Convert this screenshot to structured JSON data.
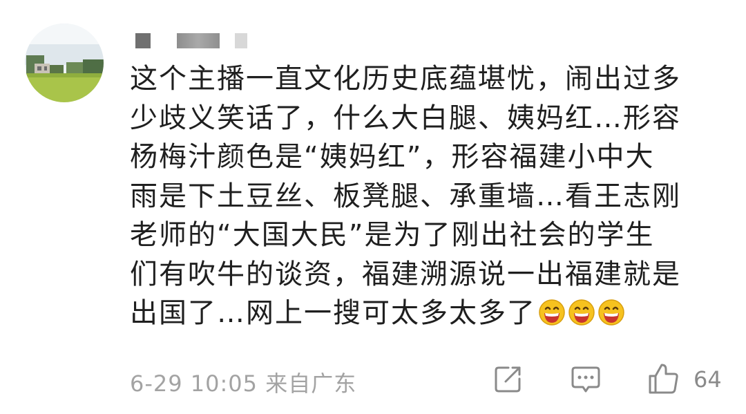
{
  "comment": {
    "lines": [
      "这个主播一直文化历史底蕴堪忧，闹出过多",
      "少歧义笑话了，什么大白腿、姨妈红…形容",
      "杨梅汁颜色是“姨妈红”，形容福建小中大",
      "雨是下土豆丝、板凳腿、承重墙…看王志刚",
      "老师的“大国大民”是为了刚出社会的学生",
      "们有吹牛的谈资，福建溯源说一出福建就是",
      "出国了…网上一搜可太多太多了"
    ],
    "emojis": [
      "laughing-face",
      "laughing-face",
      "laughing-face"
    ]
  },
  "footer": {
    "timestamp": "6-29 10:05",
    "location": "来自广东",
    "like_count": "64",
    "icons": {
      "share": "share-icon",
      "comment": "comment-icon",
      "like": "thumbs-up-icon"
    }
  },
  "colors": {
    "text": "#1f1f1f",
    "meta": "#a3a3a3",
    "icon": "#8a8a8a",
    "emoji_face": "#f6c21f",
    "emoji_mouth": "#c9352f"
  }
}
